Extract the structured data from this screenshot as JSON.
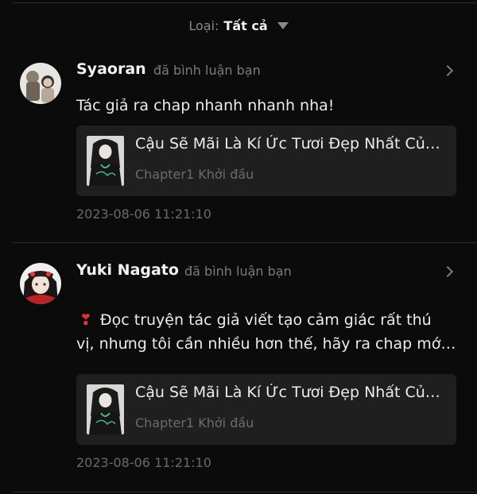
{
  "filter": {
    "label": "Loại:",
    "value": "Tất cả"
  },
  "notifications": [
    {
      "user": "Syaoran",
      "action": "đã bình luận bạn",
      "comment": [
        "Tác giả ra chap nhanh nhanh nha!"
      ],
      "story": {
        "title": "Cậu Sẽ Mãi Là Kí Ức Tươi Đẹp Nhất Của Tớ",
        "chapter": "Chapter1 Khởi đầu"
      },
      "time": "2023-08-06 11:21:10"
    },
    {
      "user": "Yuki Nagato",
      "action": "đã bình luận bạn",
      "comment_icon": "heart-icon",
      "comment": [
        "Đọc truyện tác giả viết tạo cảm giác rất thú",
        "vị, nhưng tôi cần nhiều hơn thế, hãy ra chap mới đi!"
      ],
      "story": {
        "title": "Cậu Sẽ Mãi Là Kí Ức Tươi Đẹp Nhất Của Tớ",
        "chapter": "Chapter1 Khởi đầu"
      },
      "time": "2023-08-06 11:21:10"
    }
  ],
  "colors": {
    "background": "#0b0b0b",
    "card": "#1f1f1f",
    "heart": "#e0303a"
  }
}
